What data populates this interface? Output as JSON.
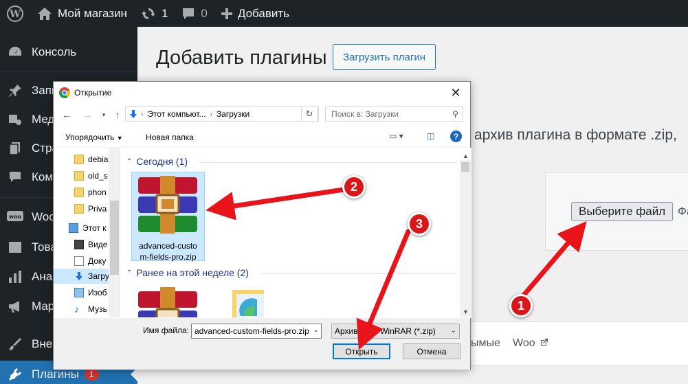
{
  "adminbar": {
    "site_name": "Мой магазин",
    "updates_count": "1",
    "comments_count": "0",
    "add_new": "Добавить"
  },
  "sidebar": {
    "items": [
      {
        "label": "Консоль",
        "icon": "dashboard-icon"
      },
      {
        "label": "Запи",
        "icon": "pin-icon"
      },
      {
        "label": "Мед",
        "icon": "media-icon"
      },
      {
        "label": "Стра",
        "icon": "pages-icon"
      },
      {
        "label": "Ком",
        "icon": "comments-icon"
      },
      {
        "label": "Woo",
        "icon": "woo-icon"
      },
      {
        "label": "Това",
        "icon": "products-icon"
      },
      {
        "label": "Ана",
        "icon": "analytics-icon"
      },
      {
        "label": "Мар",
        "icon": "marketing-icon"
      },
      {
        "label": "Внеі",
        "icon": "appearance-icon"
      },
      {
        "label": "Плагины",
        "icon": "plugins-icon",
        "badge": "1"
      }
    ]
  },
  "main": {
    "title": "Добавить плагины",
    "upload_button": "Загрузить плагин",
    "description": "архив плагина в формате .zip,",
    "choose_file": "Выберите файл",
    "no_file": "Фа",
    "tab_popular": "ымые",
    "tab_woo": "Woo"
  },
  "dialog": {
    "title": "Открытие",
    "address_parts": [
      "Этот компьют...",
      "Загрузки"
    ],
    "search_placeholder": "Поиск в: Загрузки",
    "organize": "Упорядочить",
    "new_folder": "Новая папка",
    "nav_items": [
      "debia",
      "old_s",
      "phon",
      "Priva",
      "Этот к",
      "Виде",
      "Доку",
      "Загру",
      "Изоб",
      "Музь"
    ],
    "groups": [
      {
        "label": "Сегодня (1)"
      },
      {
        "label": "Ранее на этой неделе (2)"
      }
    ],
    "file_name_line1": "advanced-custo",
    "file_name_line2": "m-fields-pro.zip",
    "filename_label": "Имя файла:",
    "filename_value": "advanced-custom-fields-pro.zip",
    "filetype_value": "Архив ZIP - WinRAR (*.zip)",
    "open_button": "Открыть",
    "cancel_button": "Отмена"
  },
  "annotations": {
    "markers": [
      "1",
      "2",
      "3"
    ],
    "color": "#d9161a"
  },
  "colors": {
    "wp_dark": "#1d2327",
    "wp_blue": "#2271b1",
    "badge_red": "#d63638"
  }
}
